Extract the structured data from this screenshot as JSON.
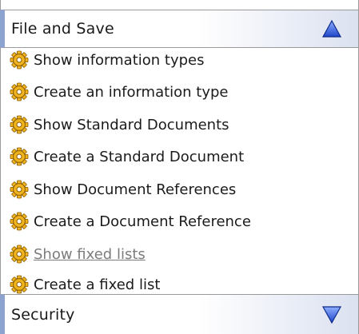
{
  "sections": {
    "file_and_save": {
      "title": "File and Save",
      "toggle_icon": "chevron-up-triangle-icon",
      "expanded": true
    },
    "security": {
      "title": "Security",
      "toggle_icon": "chevron-down-triangle-icon",
      "expanded": false
    }
  },
  "items": [
    {
      "label": "Show information types",
      "icon": "gear-icon",
      "visited": false
    },
    {
      "label": "Create an information type",
      "icon": "gear-icon",
      "visited": false
    },
    {
      "label": "Show Standard Documents",
      "icon": "gear-icon",
      "visited": false
    },
    {
      "label": "Create a Standard Document",
      "icon": "gear-icon",
      "visited": false
    },
    {
      "label": "Show Document References",
      "icon": "gear-icon",
      "visited": false
    },
    {
      "label": "Create a Document Reference",
      "icon": "gear-icon",
      "visited": false
    },
    {
      "label": "Show fixed lists",
      "icon": "gear-icon",
      "visited": true
    },
    {
      "label": "Create a fixed list",
      "icon": "gear-icon",
      "visited": false
    }
  ],
  "colors": {
    "header_accent": "#8ea2cf",
    "toggle_fill": "#3b5fd6",
    "gear_fill": "#f0b41e",
    "visited_text": "#7c7c7c"
  }
}
